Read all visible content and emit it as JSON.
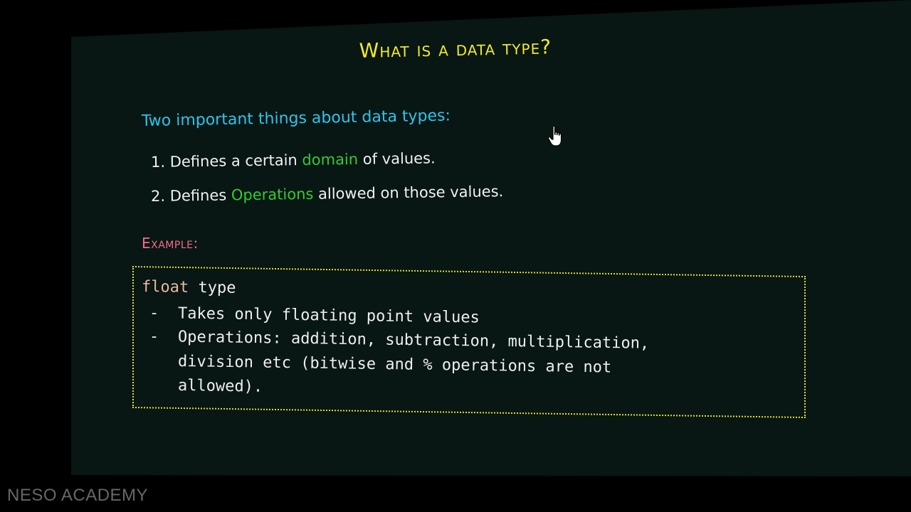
{
  "slide": {
    "title": "What is a data type?",
    "subheading": "Two important things about data types:",
    "points": [
      {
        "number": "1.",
        "before": "Defines a certain",
        "highlight": "domain",
        "after": "of values."
      },
      {
        "number": "2.",
        "before": "Defines",
        "highlight": "Operations",
        "after": "allowed on those values."
      }
    ],
    "example_label": "Example:",
    "example": {
      "keyword": "float",
      "rest_of_first_line": " type",
      "bullet_1": "Takes only floating point values",
      "bullet_2_line_1": "Operations: addition, subtraction, multiplication,",
      "bullet_2_line_2": "division etc (bitwise and % operations are not",
      "bullet_2_line_3": "allowed).",
      "dash": "-"
    }
  },
  "watermark": "NESO ACADEMY",
  "colors": {
    "title": "#f2ec1f",
    "subheading": "#2cc6ea",
    "highlight": "#33cc33",
    "example_label": "#f06e8a",
    "box_border": "#e0e020",
    "background": "#081614"
  }
}
